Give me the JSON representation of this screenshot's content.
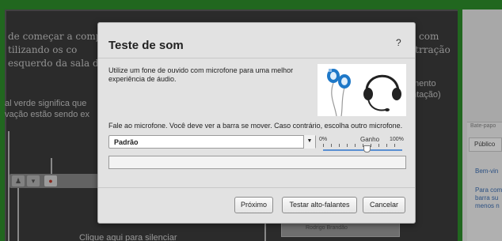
{
  "background": {
    "chalk_text_left": [
      "de começar a comp",
      "tilizando os co",
      "esquerdo da sala de"
    ],
    "chalk_text_left2": [
      "al verde significa que",
      "vação estão sendo ex"
    ],
    "chalk_text_right": [
      "o com",
      "strração"
    ],
    "chalk_text_right2": [
      "mento",
      "ntação)"
    ],
    "chalk_bottom": "Clique aqui para silenciar",
    "panel_user": "Rodrigo Brandão",
    "chat_header": "Bate-papo",
    "chat_tab": "Público",
    "chat_messages": [
      "Bem-vin",
      "Para com",
      "barra su",
      "menos n"
    ]
  },
  "dialog": {
    "title": "Teste de som",
    "help_label": "?",
    "description": "Utilize um fone de ouvido com microfone para uma melhor experiência de áudio.",
    "instruction": "Fale ao microfone. Você deve ver a barra se mover. Caso contrário, escolha outro microfone.",
    "microphone_selected": "Padrão",
    "select_arrow": "▼",
    "gain": {
      "label": "Ganho",
      "min_label": "0%",
      "max_label": "100%",
      "value_percent": 55
    },
    "level_percent": 0,
    "buttons": {
      "next": "Próximo",
      "test_speakers": "Testar alto-falantes",
      "cancel": "Cancelar"
    }
  },
  "colors": {
    "frame_green": "#2f8f2c",
    "chalkboard": "#3c3c3c",
    "slider_blue": "#5a8fd1"
  },
  "icons": [
    "earphones-icon",
    "headset-icon",
    "help-icon",
    "chevron-down-icon"
  ]
}
